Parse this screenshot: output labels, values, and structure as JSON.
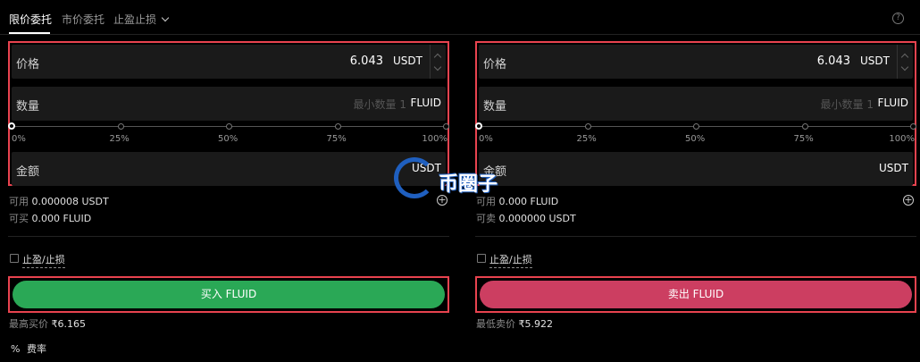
{
  "tabs": {
    "limit": "限价委托",
    "market": "市价委托",
    "tpsl": "止盈止损",
    "help": "?"
  },
  "buy": {
    "price_label": "价格",
    "price_value": "6.043",
    "price_unit": "USDT",
    "qty_label": "数量",
    "qty_placeholder": "最小数量 1",
    "qty_unit": "FLUID",
    "slider_ticks": [
      "0%",
      "25%",
      "50%",
      "75%",
      "100%"
    ],
    "amount_label": "金额",
    "amount_unit": "USDT",
    "avail_label": "可用",
    "avail_value": "0.000008 USDT",
    "can_label": "可买",
    "can_value": "0.000 FLUID",
    "tpsl_label": "止盈/止损",
    "button": "买入 FLUID",
    "best_label": "最高买价",
    "best_value": "₹6.165"
  },
  "sell": {
    "price_label": "价格",
    "price_value": "6.043",
    "price_unit": "USDT",
    "qty_label": "数量",
    "qty_placeholder": "最小数量 1",
    "qty_unit": "FLUID",
    "slider_ticks": [
      "0%",
      "25%",
      "50%",
      "75%",
      "100%"
    ],
    "amount_label": "金额",
    "amount_unit": "USDT",
    "avail_label": "可用",
    "avail_value": "0.000 FLUID",
    "can_label": "可卖",
    "can_value": "0.000000 USDT",
    "tpsl_label": "止盈/止损",
    "button": "卖出 FLUID",
    "best_label": "最低卖价",
    "best_value": "₹5.922"
  },
  "fee": {
    "icon": "%",
    "label": "费率"
  },
  "watermark": "币圈子",
  "colors": {
    "buy": "#2aa856",
    "sell": "#cc3e61",
    "highlight": "#e8434f"
  }
}
